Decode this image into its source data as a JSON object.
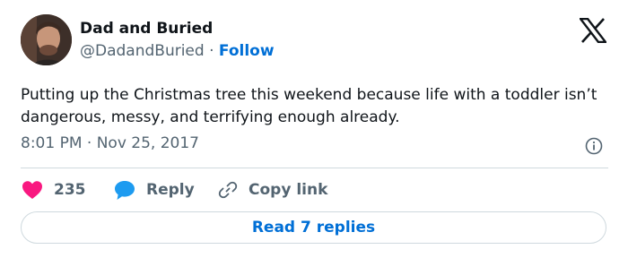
{
  "author": {
    "display_name": "Dad and Buried",
    "handle": "@DadandBuried",
    "separator": "·",
    "follow_label": "Follow"
  },
  "tweet": {
    "text": "Putting up the Christmas tree this weekend because life with a toddler isn’t dangerous, messy, and terrifying enough already.",
    "timestamp": "8:01 PM · Nov 25, 2017"
  },
  "actions": {
    "like_count": "235",
    "reply_label": "Reply",
    "copy_link_label": "Copy link"
  },
  "read_replies_label": "Read 7 replies",
  "icons": {
    "brand": "x-logo-icon",
    "info": "info-icon",
    "like": "heart-icon",
    "reply": "speech-bubble-icon",
    "copy": "link-icon"
  },
  "colors": {
    "link_blue": "#006fd6",
    "heart": "#f91880",
    "reply_bubble": "#1d9bf0",
    "secondary_text": "#536471",
    "border": "#cfd9de"
  }
}
